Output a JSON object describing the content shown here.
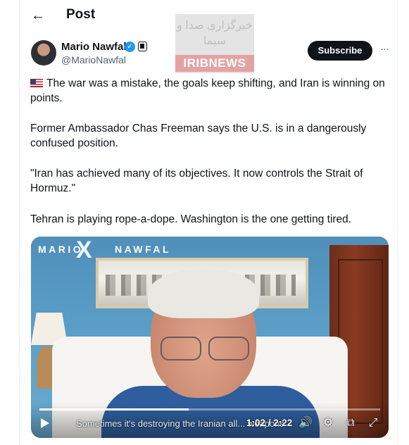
{
  "header": {
    "back_icon": "arrow-left-icon",
    "title": "Post"
  },
  "author": {
    "name": "Mario Nawfal",
    "handle": "@MarioNawfal",
    "verified_color": "#1d9bf0"
  },
  "actions": {
    "subscribe_label": "Subscribe",
    "more_label": "···"
  },
  "watermark": {
    "persian_text": "خبرگزاری صدا و سیما",
    "brand": "IRIBNEWS"
  },
  "post": {
    "line1": "The war was a mistake, the goals keep shifting, and Iran is winning on points.",
    "line2": "Former Ambassador Chas Freeman says the U.S. is in a dangerously confused position.",
    "line3": "\"Iran has achieved many of its objectives. It now controls the Strait of Hormuz.\"",
    "line4": "Tehran is playing rope-a-dope. Washington is the one getting tired."
  },
  "video": {
    "brand_left": "MARIO",
    "brand_x": "X",
    "brand_right": "NAWFAL",
    "caption": "Sometimes it's destroying the Iranian all... weapons",
    "time": "1:02 / 2:22",
    "progress_fraction": 0.437
  },
  "colors": {
    "text": "#0f1419",
    "secondary": "#536471",
    "accent": "#1d9bf0"
  }
}
